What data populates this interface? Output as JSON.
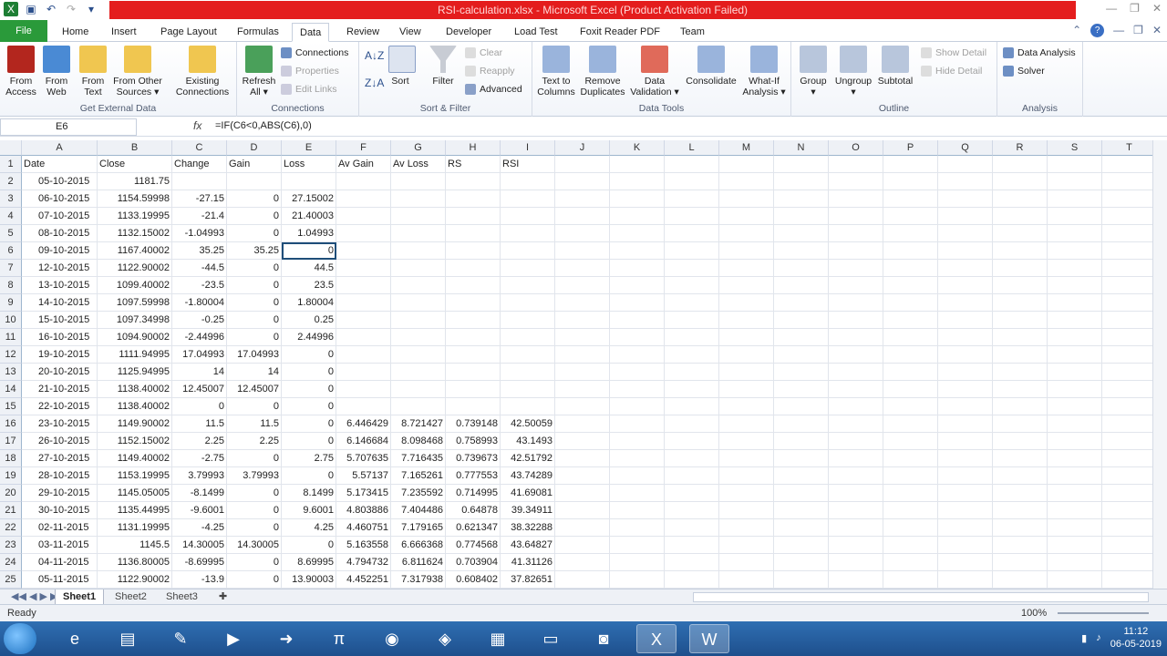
{
  "window": {
    "title": "RSI-calculation.xlsx - Microsoft Excel (Product Activation Failed)"
  },
  "qat_icons": [
    "excel-icon",
    "save-icon",
    "undo-icon",
    "redo-icon",
    "customize-icon"
  ],
  "tabs": {
    "file": "File",
    "items": [
      "Home",
      "Insert",
      "Page Layout",
      "Formulas",
      "Data",
      "Review",
      "View",
      "Developer",
      "Load Test",
      "Foxit Reader PDF",
      "Team"
    ],
    "active": "Data"
  },
  "ribbon": {
    "get_external": {
      "label": "Get External Data",
      "buttons": [
        "From\nAccess",
        "From\nWeb",
        "From\nText",
        "From Other\nSources ▾",
        "Existing\nConnections"
      ]
    },
    "connections": {
      "label": "Connections",
      "refresh": "Refresh\nAll ▾",
      "connections": "Connections",
      "properties": "Properties",
      "edit_links": "Edit Links"
    },
    "sort_filter": {
      "label": "Sort & Filter",
      "sort": "Sort",
      "filter": "Filter",
      "clear": "Clear",
      "reapply": "Reapply",
      "advanced": "Advanced"
    },
    "data_tools": {
      "label": "Data Tools",
      "buttons": [
        "Text to\nColumns",
        "Remove\nDuplicates",
        "Data\nValidation ▾",
        "Consolidate",
        "What-If\nAnalysis ▾"
      ]
    },
    "outline": {
      "label": "Outline",
      "buttons": [
        "Group\n▾",
        "Ungroup\n▾",
        "Subtotal"
      ],
      "show_detail": "Show Detail",
      "hide_detail": "Hide Detail"
    },
    "analysis": {
      "label": "Analysis",
      "data_analysis": "Data Analysis",
      "solver": "Solver"
    }
  },
  "formula_bar": {
    "name_box": "E6",
    "fx": "fx",
    "formula": "=IF(C6<0,ABS(C6),0)"
  },
  "columns": [
    "A",
    "B",
    "C",
    "D",
    "E",
    "F",
    "G",
    "H",
    "I",
    "J",
    "K",
    "L",
    "M",
    "N",
    "O",
    "P",
    "Q",
    "R",
    "S",
    "T"
  ],
  "row_numbers": [
    "1",
    "2",
    "3",
    "4",
    "5",
    "6",
    "7",
    "8",
    "9",
    "10",
    "11",
    "12",
    "13",
    "14",
    "15",
    "16",
    "17",
    "18",
    "19",
    "20",
    "21",
    "22",
    "23",
    "24",
    "25"
  ],
  "rows": [
    [
      "Date",
      "Close",
      "Change",
      "Gain",
      "Loss",
      "Av Gain",
      "Av Loss",
      "RS",
      "RSI"
    ],
    [
      "05-10-2015",
      "1181.75",
      "",
      "",
      "",
      "",
      "",
      "",
      ""
    ],
    [
      "06-10-2015",
      "1154.59998",
      "-27.15",
      "0",
      "27.15002",
      "",
      "",
      "",
      ""
    ],
    [
      "07-10-2015",
      "1133.19995",
      "-21.4",
      "0",
      "21.40003",
      "",
      "",
      "",
      ""
    ],
    [
      "08-10-2015",
      "1132.15002",
      "-1.04993",
      "0",
      "1.04993",
      "",
      "",
      "",
      ""
    ],
    [
      "09-10-2015",
      "1167.40002",
      "35.25",
      "35.25",
      "0",
      "",
      "",
      "",
      ""
    ],
    [
      "12-10-2015",
      "1122.90002",
      "-44.5",
      "0",
      "44.5",
      "",
      "",
      "",
      ""
    ],
    [
      "13-10-2015",
      "1099.40002",
      "-23.5",
      "0",
      "23.5",
      "",
      "",
      "",
      ""
    ],
    [
      "14-10-2015",
      "1097.59998",
      "-1.80004",
      "0",
      "1.80004",
      "",
      "",
      "",
      ""
    ],
    [
      "15-10-2015",
      "1097.34998",
      "-0.25",
      "0",
      "0.25",
      "",
      "",
      "",
      ""
    ],
    [
      "16-10-2015",
      "1094.90002",
      "-2.44996",
      "0",
      "2.44996",
      "",
      "",
      "",
      ""
    ],
    [
      "19-10-2015",
      "1111.94995",
      "17.04993",
      "17.04993",
      "0",
      "",
      "",
      "",
      ""
    ],
    [
      "20-10-2015",
      "1125.94995",
      "14",
      "14",
      "0",
      "",
      "",
      "",
      ""
    ],
    [
      "21-10-2015",
      "1138.40002",
      "12.45007",
      "12.45007",
      "0",
      "",
      "",
      "",
      ""
    ],
    [
      "22-10-2015",
      "1138.40002",
      "0",
      "0",
      "0",
      "",
      "",
      "",
      ""
    ],
    [
      "23-10-2015",
      "1149.90002",
      "11.5",
      "11.5",
      "0",
      "6.446429",
      "8.721427",
      "0.739148",
      "42.50059"
    ],
    [
      "26-10-2015",
      "1152.15002",
      "2.25",
      "2.25",
      "0",
      "6.146684",
      "8.098468",
      "0.758993",
      "43.1493"
    ],
    [
      "27-10-2015",
      "1149.40002",
      "-2.75",
      "0",
      "2.75",
      "5.707635",
      "7.716435",
      "0.739673",
      "42.51792"
    ],
    [
      "28-10-2015",
      "1153.19995",
      "3.79993",
      "3.79993",
      "0",
      "5.57137",
      "7.165261",
      "0.777553",
      "43.74289"
    ],
    [
      "29-10-2015",
      "1145.05005",
      "-8.1499",
      "0",
      "8.1499",
      "5.173415",
      "7.235592",
      "0.714995",
      "41.69081"
    ],
    [
      "30-10-2015",
      "1135.44995",
      "-9.6001",
      "0",
      "9.6001",
      "4.803886",
      "7.404486",
      "0.64878",
      "39.34911"
    ],
    [
      "02-11-2015",
      "1131.19995",
      "-4.25",
      "0",
      "4.25",
      "4.460751",
      "7.179165",
      "0.621347",
      "38.32288"
    ],
    [
      "03-11-2015",
      "1145.5",
      "14.30005",
      "14.30005",
      "0",
      "5.163558",
      "6.666368",
      "0.774568",
      "43.64827"
    ],
    [
      "04-11-2015",
      "1136.80005",
      "-8.69995",
      "0",
      "8.69995",
      "4.794732",
      "6.811624",
      "0.703904",
      "41.31126"
    ],
    [
      "05-11-2015",
      "1122.90002",
      "-13.9",
      "0",
      "13.90003",
      "4.452251",
      "7.317938",
      "0.608402",
      "37.82651"
    ]
  ],
  "sheets": [
    "Sheet1",
    "Sheet2",
    "Sheet3"
  ],
  "active_sheet": "Sheet1",
  "status": {
    "text": "Ready",
    "zoom": "100%"
  },
  "taskbar": {
    "apps": [
      "ie-icon",
      "explorer-icon",
      "tool-icon",
      "media-icon",
      "arrow-app-icon",
      "pi-app-icon",
      "chrome-icon",
      "vs-icon",
      "files-icon",
      "folder-icon",
      "camera-icon",
      "excel-icon",
      "word-icon"
    ],
    "time": "11:12",
    "date": "06-05-2019"
  },
  "colors": {
    "titlebar_red": "#e41d1d",
    "file_tab": "#2a9a3a",
    "taskbar": "#2f6fb3"
  }
}
